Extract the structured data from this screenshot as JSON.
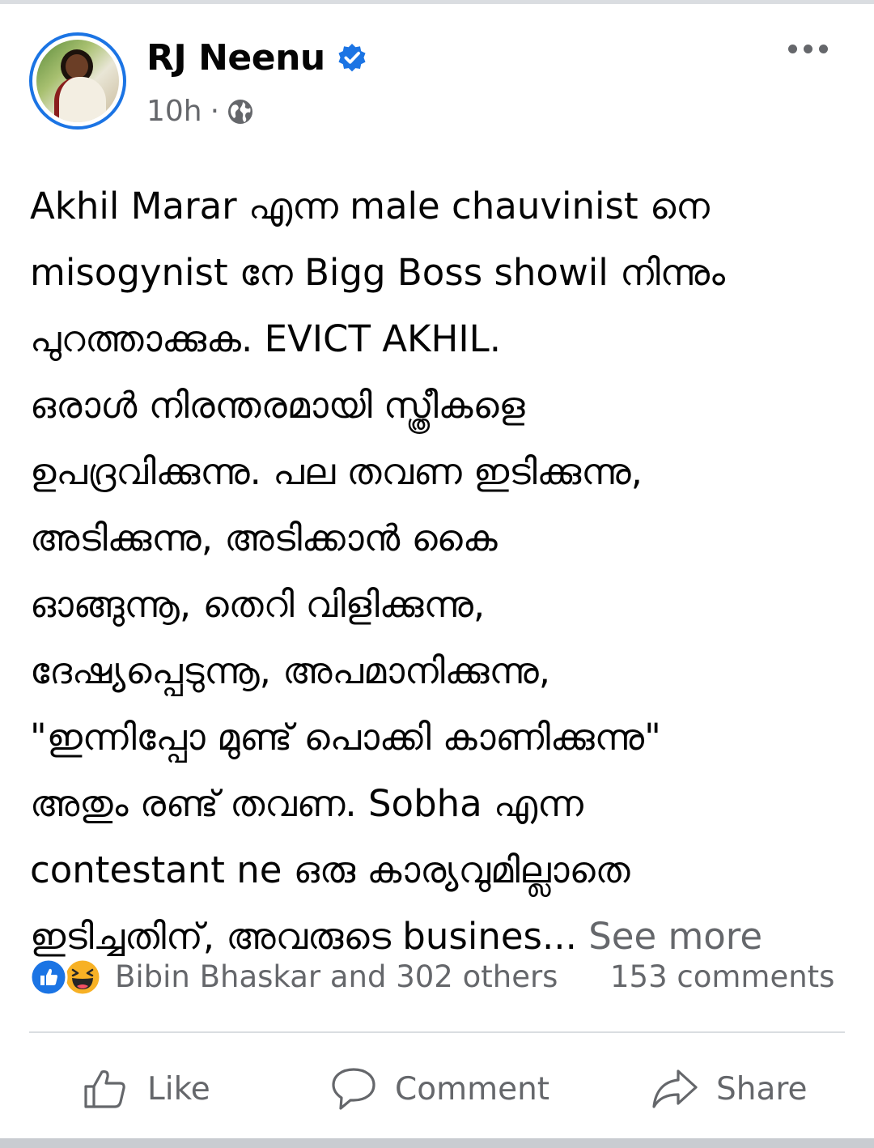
{
  "post": {
    "author": "RJ Neenu",
    "time": "10h",
    "separator": "·",
    "text_lines": [
      "Akhil Marar എന്ന male chauvinist നെ",
      "misogynist നേ Bigg Boss showil നിന്നും",
      "പുറത്താക്കുക. EVICT AKHIL.",
      "ഒരാൾ നിരന്തരമായി സ്ത്രീകളെ",
      "ഉപദ്രവിക്കുന്നു. പല തവണ ഇടിക്കുന്നു,",
      "അടിക്കുന്നു, അടിക്കാൻ കൈ",
      "ഓങ്ങുന്നൂ, തെറി വിളിക്കുന്നു,",
      "ദേഷ്യപ്പെടുന്നൂ, അപമാനിക്കുന്നു,",
      "\"ഇന്നിപ്പോ മുണ്ട് പൊക്കി കാണിക്കുന്നു\"",
      "അതും രണ്ട് തവണ. Sobha എന്ന",
      "contestant ne ഒരു കാര്യവുമില്ലാതെ",
      "ഇടിച്ചതിന്, അവരുടെ busines..."
    ],
    "see_more": "See more"
  },
  "reactions": {
    "summary": "Bibin Bhaskar and 302 others",
    "comments": "153 comments",
    "icons": [
      "like-reaction-icon",
      "haha-reaction-icon"
    ]
  },
  "actions": {
    "like": "Like",
    "comment": "Comment",
    "share": "Share"
  },
  "colors": {
    "accent": "#1b74e4",
    "secondary_text": "#65676b",
    "primary_text": "#050505",
    "divider": "#dadde1",
    "haha": "#f7b125"
  }
}
